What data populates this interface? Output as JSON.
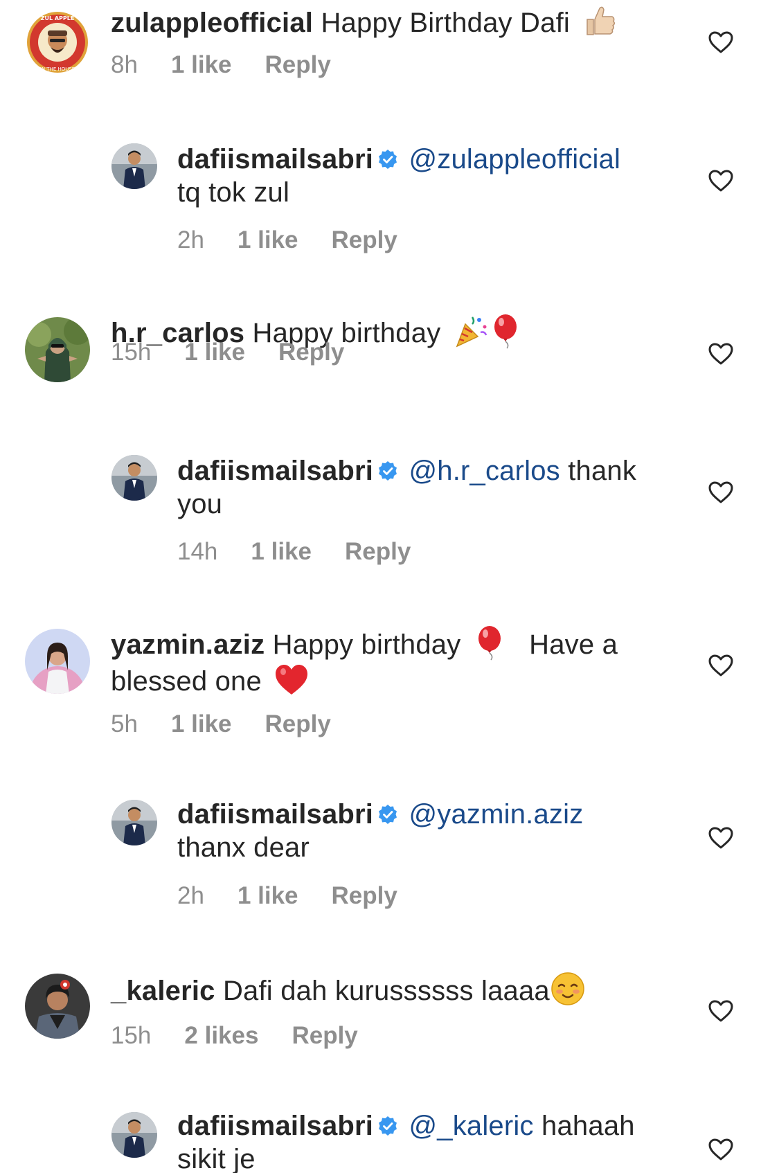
{
  "comments": [
    {
      "username": "zulappleofficial",
      "text": "Happy Birthday Dafi",
      "emoji": "thumbs-up",
      "time": "8h",
      "likes": "1 like",
      "reply": "Reply",
      "avatar_text": "BRO. ZUL APPLE • IN THE HOUSE"
    },
    {
      "username": "dafiismailsabri",
      "mention": "@zulappleofficial",
      "text": "tq tok zul",
      "time": "2h",
      "likes": "1 like",
      "reply": "Reply"
    },
    {
      "username": "h.r_carlos",
      "text": "Happy birthday",
      "emoji": "party-popper, balloon",
      "time": "15h",
      "likes": "1 like",
      "reply": "Reply"
    },
    {
      "username": "dafiismailsabri",
      "mention": "@h.r_carlos",
      "text": "thank you",
      "time": "14h",
      "likes": "1 like",
      "reply": "Reply"
    },
    {
      "username": "yazmin.aziz",
      "text_a": "Happy birthday",
      "text_b": "Have a blessed one",
      "emoji": "balloon, red-heart",
      "time": "5h",
      "likes": "1 like",
      "reply": "Reply"
    },
    {
      "username": "dafiismailsabri",
      "mention": "@yazmin.aziz",
      "text": "thanx dear",
      "time": "2h",
      "likes": "1 like",
      "reply": "Reply"
    },
    {
      "username": "_kaleric",
      "text": "Dafi dah kurussssss laaaa",
      "emoji": "smiling-face",
      "time": "15h",
      "likes": "2 likes",
      "reply": "Reply"
    },
    {
      "username": "dafiismailsabri",
      "mention": "@_kaleric",
      "text": "hahaah sikit je"
    }
  ],
  "colors": {
    "text": "#262626",
    "meta": "#8e8e8e",
    "mention": "#1a4a8a",
    "verified": "#3897f0"
  }
}
